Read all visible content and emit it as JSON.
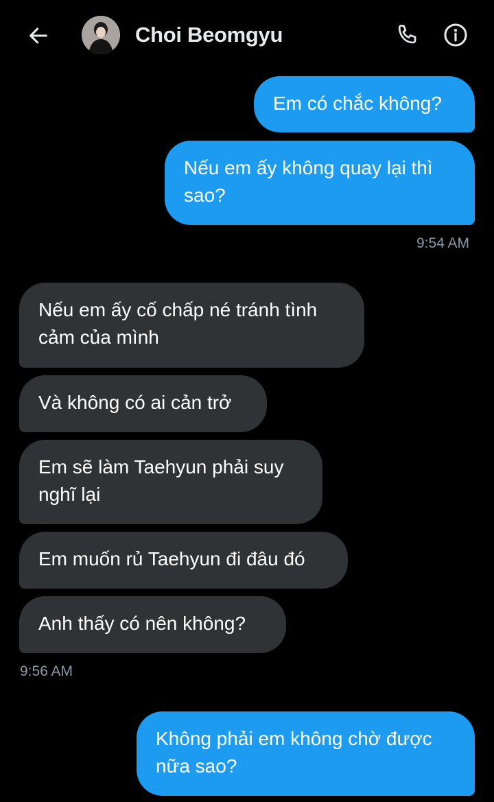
{
  "header": {
    "contact_name": "Choi Beomgyu",
    "back_icon": "arrow-left-icon",
    "call_icon": "phone-icon",
    "info_icon": "info-icon"
  },
  "messages": [
    {
      "side": "out",
      "text": "Em có chắc không?"
    },
    {
      "side": "out",
      "text": "Nếu em ấy không quay lại thì sao?"
    },
    {
      "side": "in",
      "text": "Nếu em ấy cố chấp né tránh tình cảm của mình"
    },
    {
      "side": "in",
      "text": "Và không có ai cản trở"
    },
    {
      "side": "in",
      "text": "Em sẽ làm Taehyun phải suy nghĩ lại"
    },
    {
      "side": "in",
      "text": "Em muốn rủ Taehyun đi đâu đó"
    },
    {
      "side": "in",
      "text": "Anh thấy có nên không?"
    },
    {
      "side": "out",
      "text": "Không phải em không chờ được nữa sao?"
    }
  ],
  "timestamps": {
    "out_group_1": "9:54 AM",
    "in_group_1": "9:56 AM"
  },
  "colors": {
    "background": "#000000",
    "outgoing_bubble": "#1d9bf0",
    "incoming_bubble": "#2f3336",
    "timestamp": "#8b98a5"
  }
}
